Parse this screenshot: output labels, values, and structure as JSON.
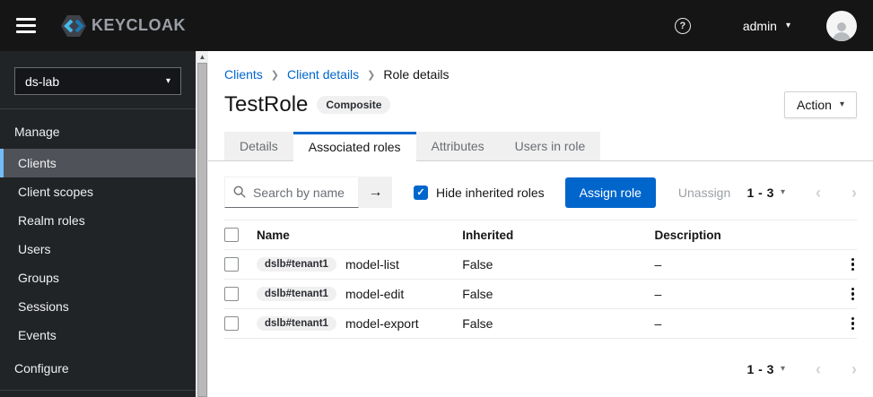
{
  "masthead": {
    "brand": "KEYCLOAK",
    "username": "admin"
  },
  "sidebar": {
    "realm_selector": "ds-lab",
    "manage_label": "Manage",
    "configure_label": "Configure",
    "items": [
      {
        "label": "Clients",
        "active": true
      },
      {
        "label": "Client scopes",
        "active": false
      },
      {
        "label": "Realm roles",
        "active": false
      },
      {
        "label": "Users",
        "active": false
      },
      {
        "label": "Groups",
        "active": false
      },
      {
        "label": "Sessions",
        "active": false
      },
      {
        "label": "Events",
        "active": false
      }
    ]
  },
  "breadcrumb": {
    "items": [
      "Clients",
      "Client details",
      "Role details"
    ]
  },
  "page": {
    "title": "TestRole",
    "badge": "Composite",
    "action_label": "Action"
  },
  "tabs": [
    {
      "label": "Details",
      "active": false
    },
    {
      "label": "Associated roles",
      "active": true
    },
    {
      "label": "Attributes",
      "active": false
    },
    {
      "label": "Users in role",
      "active": false
    }
  ],
  "toolbar": {
    "search_placeholder": "Search by name",
    "hide_inherited_label": "Hide inherited roles",
    "hide_inherited_checked": true,
    "assign_label": "Assign role",
    "unassign_label": "Unassign",
    "pagination_range": "1 - 3"
  },
  "table": {
    "columns": [
      "Name",
      "Inherited",
      "Description"
    ],
    "rows": [
      {
        "badge": "dslb#tenant1",
        "name": "model-list",
        "inherited": "False",
        "description": "–"
      },
      {
        "badge": "dslb#tenant1",
        "name": "model-edit",
        "inherited": "False",
        "description": "–"
      },
      {
        "badge": "dslb#tenant1",
        "name": "model-export",
        "inherited": "False",
        "description": "–"
      }
    ]
  },
  "footer": {
    "pagination_range": "1 - 3"
  },
  "colors": {
    "accent": "#0066cc",
    "masthead_bg": "#151515",
    "sidebar_bg": "#212427",
    "active_nav_bg": "#4f5258",
    "active_nav_border": "#73bcf7",
    "logo_blue_light": "#45b8e8",
    "logo_blue_dark": "#1b78b3"
  }
}
